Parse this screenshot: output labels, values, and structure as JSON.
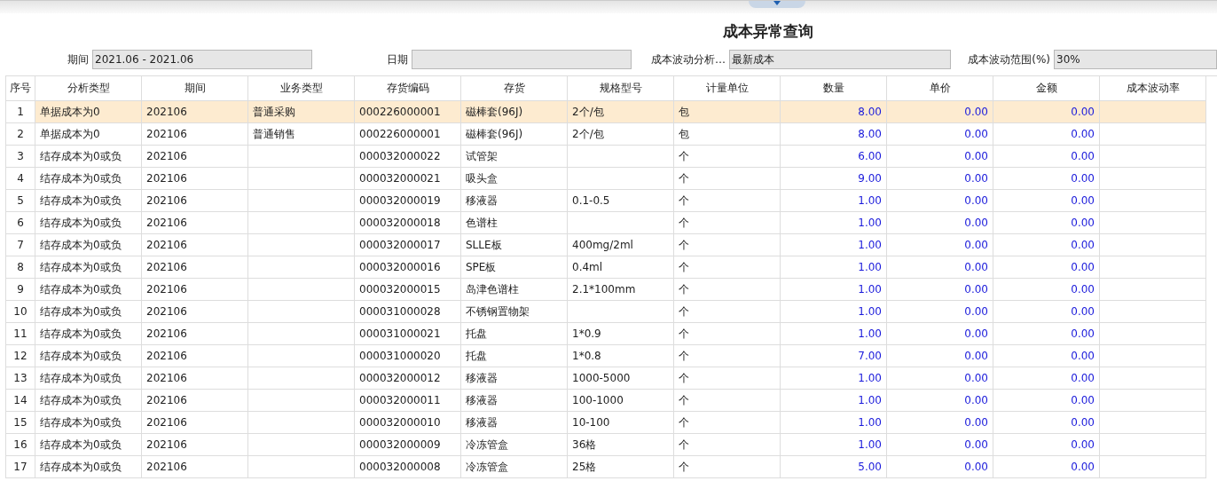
{
  "title": "成本异常查询",
  "filters": [
    {
      "label": "期间",
      "value": "2021.06 - 2021.06"
    },
    {
      "label": "日期"
    },
    {
      "label": "成本波动分析…",
      "value": "最新成本"
    },
    {
      "label": "成本波动范围(%)",
      "value": "30%"
    }
  ],
  "table": {
    "columns": [
      "序号",
      "分析类型",
      "期间",
      "业务类型",
      "存货编码",
      "存货",
      "规格型号",
      "计量单位",
      "数量",
      "单价",
      "金额",
      "成本波动率"
    ],
    "rows": [
      {
        "selected": true,
        "cells": [
          "1",
          "单据成本为0",
          "202106",
          "普通采购",
          "000226000001",
          "磁棒套(96J)",
          "2个/包",
          "包",
          "8.00",
          "0.00",
          "0.00",
          ""
        ]
      },
      {
        "selected": false,
        "cells": [
          "2",
          "单据成本为0",
          "202106",
          "普通销售",
          "000226000001",
          "磁棒套(96J)",
          "2个/包",
          "包",
          "8.00",
          "0.00",
          "0.00",
          ""
        ]
      },
      {
        "selected": false,
        "cells": [
          "3",
          "结存成本为0或负",
          "202106",
          "",
          "000032000022",
          "试管架",
          "",
          "个",
          "6.00",
          "0.00",
          "0.00",
          ""
        ]
      },
      {
        "selected": false,
        "cells": [
          "4",
          "结存成本为0或负",
          "202106",
          "",
          "000032000021",
          "吸头盒",
          "",
          "个",
          "9.00",
          "0.00",
          "0.00",
          ""
        ]
      },
      {
        "selected": false,
        "cells": [
          "5",
          "结存成本为0或负",
          "202106",
          "",
          "000032000019",
          "移液器",
          "0.1-0.5",
          "个",
          "1.00",
          "0.00",
          "0.00",
          ""
        ]
      },
      {
        "selected": false,
        "cells": [
          "6",
          "结存成本为0或负",
          "202106",
          "",
          "000032000018",
          "色谱柱",
          "",
          "个",
          "1.00",
          "0.00",
          "0.00",
          ""
        ]
      },
      {
        "selected": false,
        "cells": [
          "7",
          "结存成本为0或负",
          "202106",
          "",
          "000032000017",
          "SLLE板",
          "400mg/2ml",
          "个",
          "1.00",
          "0.00",
          "0.00",
          ""
        ]
      },
      {
        "selected": false,
        "cells": [
          "8",
          "结存成本为0或负",
          "202106",
          "",
          "000032000016",
          "SPE板",
          "0.4ml",
          "个",
          "1.00",
          "0.00",
          "0.00",
          ""
        ]
      },
      {
        "selected": false,
        "cells": [
          "9",
          "结存成本为0或负",
          "202106",
          "",
          "000032000015",
          "岛津色谱柱",
          "2.1*100mm",
          "个",
          "1.00",
          "0.00",
          "0.00",
          ""
        ]
      },
      {
        "selected": false,
        "cells": [
          "10",
          "结存成本为0或负",
          "202106",
          "",
          "000031000028",
          "不锈钢置物架",
          "",
          "个",
          "1.00",
          "0.00",
          "0.00",
          ""
        ]
      },
      {
        "selected": false,
        "cells": [
          "11",
          "结存成本为0或负",
          "202106",
          "",
          "000031000021",
          "托盘",
          "1*0.9",
          "个",
          "1.00",
          "0.00",
          "0.00",
          ""
        ]
      },
      {
        "selected": false,
        "cells": [
          "12",
          "结存成本为0或负",
          "202106",
          "",
          "000031000020",
          "托盘",
          "1*0.8",
          "个",
          "7.00",
          "0.00",
          "0.00",
          ""
        ]
      },
      {
        "selected": false,
        "cells": [
          "13",
          "结存成本为0或负",
          "202106",
          "",
          "000032000012",
          "移液器",
          "1000-5000",
          "个",
          "1.00",
          "0.00",
          "0.00",
          ""
        ]
      },
      {
        "selected": false,
        "cells": [
          "14",
          "结存成本为0或负",
          "202106",
          "",
          "000032000011",
          "移液器",
          "100-1000",
          "个",
          "1.00",
          "0.00",
          "0.00",
          ""
        ]
      },
      {
        "selected": false,
        "cells": [
          "15",
          "结存成本为0或负",
          "202106",
          "",
          "000032000010",
          "移液器",
          "10-100",
          "个",
          "1.00",
          "0.00",
          "0.00",
          ""
        ]
      },
      {
        "selected": false,
        "cells": [
          "16",
          "结存成本为0或负",
          "202106",
          "",
          "000032000009",
          "冷冻管盒",
          "36格",
          "个",
          "1.00",
          "0.00",
          "0.00",
          ""
        ]
      },
      {
        "selected": false,
        "cells": [
          "17",
          "结存成本为0或负",
          "202106",
          "",
          "000032000008",
          "冷冻管盒",
          "25格",
          "个",
          "5.00",
          "0.00",
          "0.00",
          ""
        ]
      }
    ]
  }
}
